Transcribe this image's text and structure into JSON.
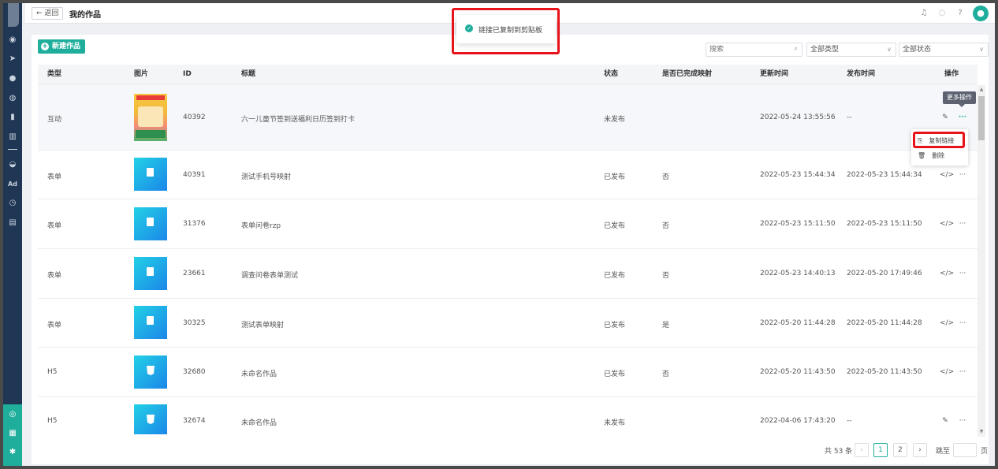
{
  "header": {
    "back_label": "返回",
    "title": "我的作品"
  },
  "toolbar": {
    "new_label": "新建作品",
    "search_placeholder": "搜索",
    "type_select": "全部类型",
    "status_select": "全部状态"
  },
  "toast": {
    "message": "链接已复制到剪贴板"
  },
  "table": {
    "headers": {
      "type": "类型",
      "image": "图片",
      "id": "ID",
      "title": "标题",
      "status": "状态",
      "mapped": "是否已完成映射",
      "updated": "更新时间",
      "published": "发布时间",
      "actions": "操作"
    },
    "rows": [
      {
        "type": "互动",
        "id": "40392",
        "title": "六一儿童节签到送福利日历签到打卡",
        "status": "未发布",
        "mapped": "",
        "updated": "2022-05-24 13:55:56",
        "published": "--",
        "thumb": "poster"
      },
      {
        "type": "表单",
        "id": "40391",
        "title": "测试手机号映射",
        "status": "已发布",
        "mapped": "否",
        "updated": "2022-05-23 15:44:34",
        "published": "2022-05-23 15:44:34",
        "thumb": "form"
      },
      {
        "type": "表单",
        "id": "31376",
        "title": "表单问卷rzp",
        "status": "已发布",
        "mapped": "否",
        "updated": "2022-05-23 15:11:50",
        "published": "2022-05-23 15:11:50",
        "thumb": "form"
      },
      {
        "type": "表单",
        "id": "23661",
        "title": "调查问卷表单测试",
        "status": "已发布",
        "mapped": "否",
        "updated": "2022-05-23 14:40:13",
        "published": "2022-05-20 17:49:46",
        "thumb": "form"
      },
      {
        "type": "表单",
        "id": "30325",
        "title": "测试表单映射",
        "status": "已发布",
        "mapped": "是",
        "updated": "2022-05-20 11:44:28",
        "published": "2022-05-20 11:44:28",
        "thumb": "form"
      },
      {
        "type": "H5",
        "id": "32680",
        "title": "未命名作品",
        "status": "已发布",
        "mapped": "否",
        "updated": "2022-05-20 11:43:50",
        "published": "2022-05-20 11:43:50",
        "thumb": "h5"
      },
      {
        "type": "H5",
        "id": "32674",
        "title": "未命名作品",
        "status": "未发布",
        "mapped": "",
        "updated": "2022-04-06 17:43:20",
        "published": "--",
        "thumb": "h5"
      }
    ]
  },
  "tooltip": {
    "more": "更多操作"
  },
  "menu": {
    "copy_link": "复制链接",
    "delete": "删除"
  },
  "pagination": {
    "total": "共 53 条",
    "pages": [
      "1",
      "2"
    ],
    "jump_label": "跳至",
    "page_unit": "页"
  },
  "colors": {
    "accent": "#1fae9c",
    "sidebar": "#1f3654",
    "highlight_box": "#e8121a"
  }
}
